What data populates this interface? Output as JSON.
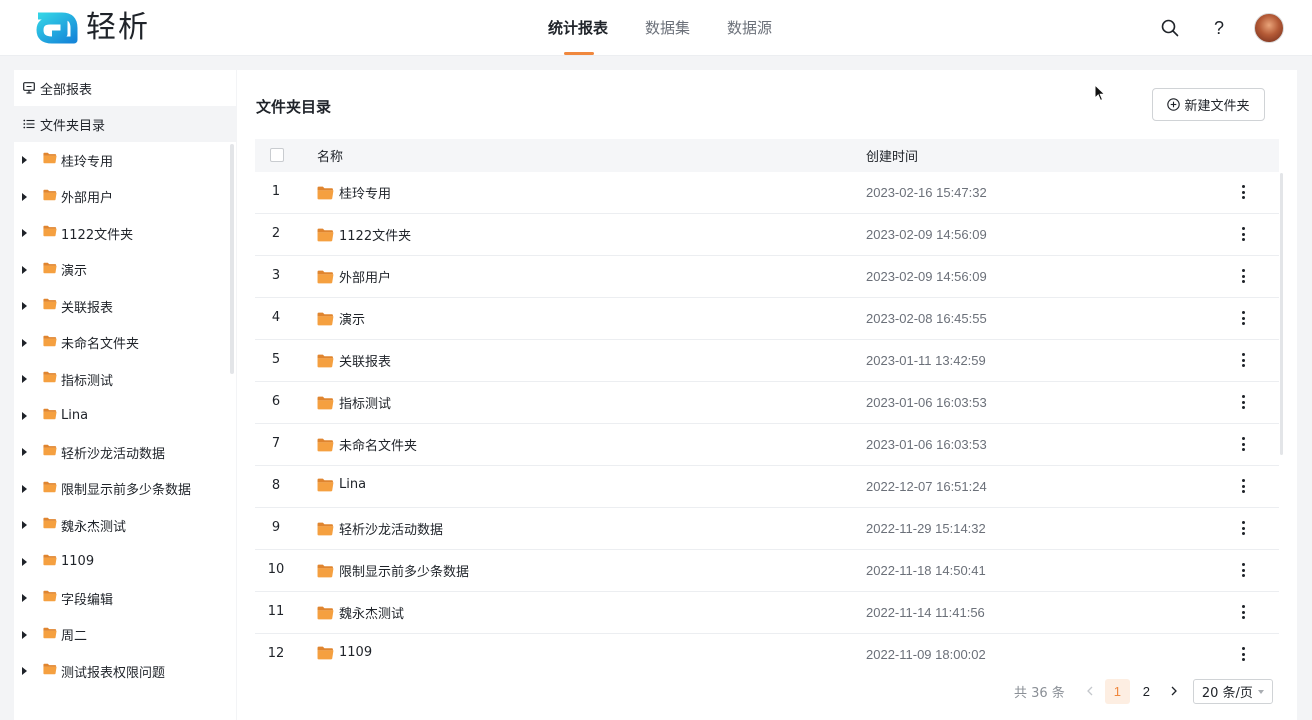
{
  "app": {
    "logo_text": "轻析",
    "brand_color": "#1ec0d6",
    "accent_color": "#f0883e"
  },
  "nav": {
    "tabs": [
      {
        "label": "统计报表",
        "active": true
      },
      {
        "label": "数据集",
        "active": false
      },
      {
        "label": "数据源",
        "active": false
      }
    ]
  },
  "header_icons": {
    "search": "search-icon",
    "help": "?",
    "avatar": "avatar"
  },
  "sidebar": {
    "all_reports": "全部报表",
    "folder_directory": "文件夹目录",
    "folders": [
      "桂玲专用",
      "外部用户",
      "1122文件夹",
      "演示",
      "关联报表",
      "未命名文件夹",
      "指标测试",
      "Lina",
      "轻析沙龙活动数据",
      "限制显示前多少条数据",
      "魏永杰测试",
      "1109",
      "字段编辑",
      "周二",
      "测试报表权限问题"
    ]
  },
  "main": {
    "title": "文件夹目录",
    "new_folder_label": "新建文件夹",
    "columns": {
      "name": "名称",
      "created": "创建时间"
    },
    "rows": [
      {
        "idx": "1",
        "name": "桂玲专用",
        "time": "2023-02-16 15:47:32"
      },
      {
        "idx": "2",
        "name": "1122文件夹",
        "time": "2023-02-09 14:56:09"
      },
      {
        "idx": "3",
        "name": "外部用户",
        "time": "2023-02-09 14:56:09"
      },
      {
        "idx": "4",
        "name": "演示",
        "time": "2023-02-08 16:45:55"
      },
      {
        "idx": "5",
        "name": "关联报表",
        "time": "2023-01-11 13:42:59"
      },
      {
        "idx": "6",
        "name": "指标测试",
        "time": "2023-01-06 16:03:53"
      },
      {
        "idx": "7",
        "name": "未命名文件夹",
        "time": "2023-01-06 16:03:53"
      },
      {
        "idx": "8",
        "name": "Lina",
        "time": "2022-12-07 16:51:24"
      },
      {
        "idx": "9",
        "name": "轻析沙龙活动数据",
        "time": "2022-11-29 15:14:32"
      },
      {
        "idx": "10",
        "name": "限制显示前多少条数据",
        "time": "2022-11-18 14:50:41"
      },
      {
        "idx": "11",
        "name": "魏永杰测试",
        "time": "2022-11-14 11:41:56"
      },
      {
        "idx": "12",
        "name": "1109",
        "time": "2022-11-09 18:00:02"
      }
    ]
  },
  "pagination": {
    "total": "共 36 条",
    "pages": [
      "1",
      "2"
    ],
    "current": "1",
    "page_size": "20 条/页"
  }
}
